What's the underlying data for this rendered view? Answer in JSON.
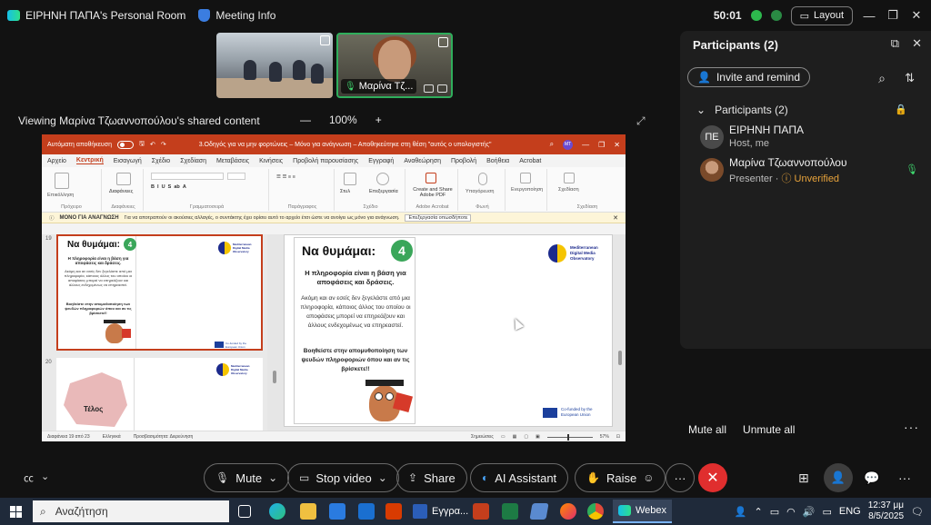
{
  "topbar": {
    "room_title": "ΕΙΡΗΝΗ ΠΑΠΑ's Personal Room",
    "meeting_info": "Meeting Info",
    "timer": "50:01",
    "layout_label": "Layout"
  },
  "videos": {
    "presenter_name": "Μαρίνα Τζ..."
  },
  "share": {
    "viewing_label": "Viewing Μαρίνα Τζωαννοπούλου's shared content",
    "zoom_minus": "—",
    "zoom_level": "100%",
    "zoom_plus": "+"
  },
  "ppt": {
    "autosave": "Αυτόματη αποθήκευση",
    "doc_title": "3.Οδηγός για να μην φορτώνεις – Μόνο για ανάγνωση – Αποθηκεύτηκε στη θέση \"αυτός ο υπολογιστής\"",
    "user_initials": "ΜΤ",
    "menu": [
      "Αρχείο",
      "Κεντρική",
      "Εισαγωγή",
      "Σχέδιο",
      "Σχεδίαση",
      "Μεταβάσεις",
      "Κινήσεις",
      "Προβολή παρουσίασης",
      "Εγγραφή",
      "Αναθεώρηση",
      "Προβολή",
      "Βοήθεια",
      "Acrobat"
    ],
    "ribbon_groups": {
      "clipboard": "Πρόχειρο",
      "slides": "Διαφάνειες",
      "font": "Γραμματοσειρά",
      "paragraph": "Παράγραφος",
      "drawing": "Σχέδιο",
      "edit": "Επεξεργασία",
      "adobe": "Adobe Acrobat",
      "voice": "Φωνή",
      "designer": "Σχεδίαση"
    },
    "ribbon_labels": {
      "paste": "Επικόλληση",
      "new_slide": "Διαφάνειες",
      "styles": "Στυλ",
      "editing": "Επεξεργασία",
      "create_pdf": "Create and Share Adobe PDF",
      "dictate": "Υπαγόρευση",
      "addins": "Ενεργοποίηση",
      "designer": "Σχεδίαση"
    },
    "readonly_title": "ΜΟΝΟ ΓΙΑ ΑΝΑΓΝΩΣΗ",
    "readonly_text": "Για να αποτραπούν οι ακούσιες αλλαγές, ο συντάκτης έχει ορίσει αυτό το αρχείο έτσι ώστε να ανοίγει ως μόνο για ανάγνωση.",
    "readonly_button": "Επεξεργασία οπωσδήποτε",
    "slide_numbers": [
      "19",
      "20"
    ],
    "status_slide": "Διαφάνεια 19 από 23",
    "status_lang": "Ελληνικά",
    "status_access": "Προσβασιμότητα: Διερεύνηση",
    "status_notes": "Σημειώσεις",
    "status_zoom": "57%"
  },
  "slide": {
    "title": "Να θυμάμαι:",
    "number": "4",
    "subtitle": "Η πληροφορία είναι η βάση για αποφάσεις και δράσεις.",
    "body": "Ακόμη και αν εσείς δεν ξεγελάστε από μια πληροφορία, κάποιος άλλος του οποίου οι αποφάσεις μπορεί να επηρεάζουν και άλλους ενδεχομένως να επηρεαστεί.",
    "cta": "Βοηθείστε στην απομυθοποίηση των ψευδών πληροφοριών όπου και αν τις βρίσκετε!!",
    "logo_text": "Mediterranean Digital Media Observatory",
    "eu_text": "Co-funded by the European Union",
    "end_title": "Τέλος"
  },
  "participants": {
    "title": "Participants (2)",
    "invite": "Invite and remind",
    "group_label": "Participants (2)",
    "list": [
      {
        "initials": "ΠΕ",
        "name": "ΕΙΡΗΝΗ ΠΑΠΑ",
        "role": "Host, me",
        "status": ""
      },
      {
        "initials": "",
        "name": "Μαρίνα Τζωαννοπούλου",
        "role": "Presenter · ",
        "status": "Unverified"
      }
    ],
    "mute_all": "Mute all",
    "unmute_all": "Unmute all"
  },
  "controls": {
    "mute": "Mute",
    "stop_video": "Stop video",
    "share": "Share",
    "ai_assistant": "AI Assistant",
    "raise": "Raise"
  },
  "taskbar": {
    "search_placeholder": "Αναζήτηση",
    "word_app": "Εγγρα...",
    "webex_app": "Webex",
    "lang": "ENG",
    "time": "12:37 μμ",
    "date": "8/5/2025"
  },
  "colors": {
    "ppt_accent": "#c43e1c",
    "end_call": "#e02e2e",
    "speaking_border": "#2fae5b",
    "unverified": "#e8a33b"
  }
}
